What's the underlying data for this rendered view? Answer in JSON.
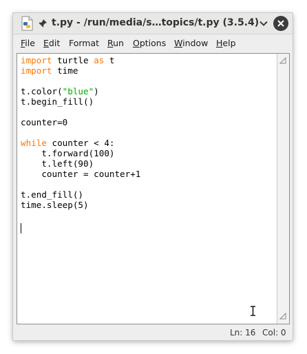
{
  "window": {
    "title": "t.py - /run/media/s…topics/t.py (3.5.4)"
  },
  "menu": {
    "file": {
      "accel": "F",
      "rest": "ile"
    },
    "edit": {
      "accel": "E",
      "rest": "dit"
    },
    "format": {
      "accel": "",
      "rest": "Format"
    },
    "run": {
      "accel": "R",
      "rest": "un"
    },
    "options": {
      "accel": "O",
      "rest": "ptions"
    },
    "window": {
      "accel": "W",
      "rest": "indow"
    },
    "help": {
      "accel": "H",
      "rest": "elp"
    }
  },
  "editor": {
    "lines": [
      {
        "kw1": "import",
        "text1": " turtle ",
        "kw2": "as",
        "text2": " t"
      },
      {
        "kw1": "import",
        "text1": " time"
      },
      {
        "text1": ""
      },
      {
        "text1": "t.color(",
        "str": "\"blue\"",
        "text2": ")"
      },
      {
        "text1": "t.begin_fill()"
      },
      {
        "text1": ""
      },
      {
        "text1": "counter=0"
      },
      {
        "text1": ""
      },
      {
        "kw1": "while",
        "text1": " counter < 4:"
      },
      {
        "text1": "    t.forward(100)"
      },
      {
        "text1": "    t.left(90)"
      },
      {
        "text1": "    counter = counter+1"
      },
      {
        "text1": ""
      },
      {
        "text1": "t.end_fill()"
      },
      {
        "text1": "time.sleep(5)"
      }
    ]
  },
  "status": {
    "line": "Ln: 16",
    "col": "Col: 0"
  },
  "colors": {
    "keyword": "#ff7700",
    "string": "#00aa00"
  }
}
